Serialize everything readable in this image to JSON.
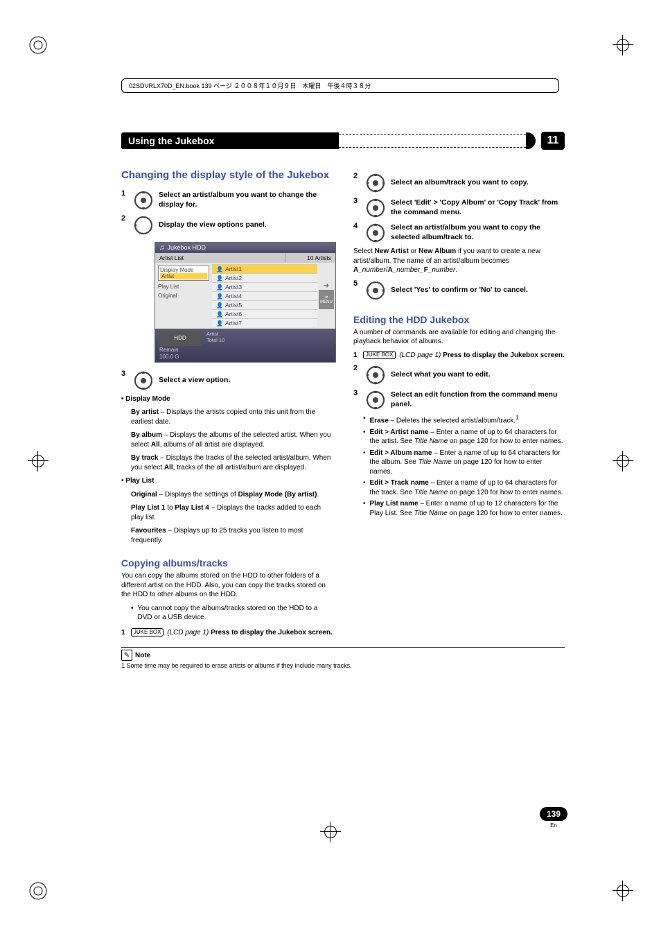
{
  "top_box": "02SDVRLX70D_EN.book  139 ページ  ２００８年１０月９日　木曜日　午後４時３８分",
  "header": {
    "title": "Using the Jukebox",
    "chapter": "11"
  },
  "left": {
    "h1": "Changing the display style of the Jukebox",
    "s1": {
      "num": "1",
      "text": "Select an artist/album you want to change the display for."
    },
    "s2": {
      "num": "2",
      "text": "Display the view options panel."
    },
    "jb": {
      "title": "Jukebox  HDD",
      "sub_left": "Artist List",
      "sub_right": "10 Artists",
      "side_mode_label": "Display Mode",
      "side_mode_val": "Artist",
      "side_playlist": "Play List",
      "side_original": "Original",
      "rows": [
        "Artist1",
        "Artist2",
        "Artist3",
        "Artist4",
        "Artist5",
        "Artist6",
        "Artist7"
      ],
      "menu_label": "MENU",
      "footer_hdd": "HDD",
      "footer_remain1": "Remain",
      "footer_remain2": "100.0 G",
      "footer_artist": "Artist",
      "footer_total": "Total   10"
    },
    "s3": {
      "num": "3",
      "text": "Select a view option."
    },
    "dm_label": "• Display Mode",
    "dm_artist_b": "By artist",
    "dm_artist_t": " – Displays the artists copied onto this unit from the earliest date.",
    "dm_album_b": "By album",
    "dm_album_t1": " – Displays the albums of the selected artist. When you select ",
    "dm_album_all": "All",
    "dm_album_t2": ", albums of all artist are displayed.",
    "dm_track_b": "By track",
    "dm_track_t1": " – Displays the tracks of the selected artist/album. When you select ",
    "dm_track_all": "All",
    "dm_track_t2": ", tracks of the all artist/album are displayed.",
    "pl_label": "• Play List",
    "pl_orig_b": "Original",
    "pl_orig_t1": " – Displays the settings of ",
    "pl_orig_t1b": "Display Mode (By artist)",
    "pl_orig_t2": ".",
    "pl_list_b1": "Play List 1",
    "pl_list_mid": " to ",
    "pl_list_b2": "Play List 4",
    "pl_list_t": " – Displays the tracks added to each play list.",
    "pl_fav_b": "Favourites",
    "pl_fav_t": " – Displays up to 25 tracks you listen to most frequently.",
    "h2": "Copying albums/tracks",
    "copy_intro": "You can copy the albums stored on the HDD to other folders of a different artist on the HDD. Also, you can copy the tracks stored on the HDD to other albums on the HDD.",
    "copy_bullet": "You cannot copy the albums/tracks stored on the HDD to a DVD or a USB device.",
    "copy_s1_num": "1",
    "copy_s1_key": "JUKE BOX",
    "copy_s1_lcd": "(LCD page 1)",
    "copy_s1_text": " Press to display the Jukebox screen."
  },
  "right": {
    "s2": {
      "num": "2",
      "text": "Select an album/track you want to copy."
    },
    "s3": {
      "num": "3",
      "text": "Select 'Edit' > 'Copy Album' or 'Copy Track' from the command menu."
    },
    "s4": {
      "num": "4",
      "text": "Select an artist/album you want to copy the selected album/track to."
    },
    "s4_body1": "Select ",
    "s4_na": "New Artist",
    "s4_or": " or ",
    "s4_nalb": "New Album",
    "s4_body2": " if you want to create a new artist/album. The name of an artist/album becomes ",
    "s4_pat_a1": "A",
    "s4_pat_n1": "_number",
    "s4_pat_slash": "/",
    "s4_pat_a2": "A",
    "s4_pat_n2": "_number_",
    "s4_pat_f": "F",
    "s4_pat_n3": "_number",
    "s4_dot": ".",
    "s5": {
      "num": "5",
      "text": "Select 'Yes' to confirm or 'No' to cancel."
    },
    "h1": "Editing the HDD Jukebox",
    "edit_intro": "A number of commands are available for editing and changing the playback behavior of albums.",
    "e1_num": "1",
    "e1_key": "JUKE BOX",
    "e1_lcd": "(LCD page 1)",
    "e1_text": " Press to display the Jukebox screen.",
    "e2": {
      "num": "2",
      "text": "Select what you want to edit."
    },
    "e3": {
      "num": "3",
      "text": "Select an edit function from the command menu panel."
    },
    "b_erase_b": "Erase",
    "b_erase_t": " – Deletes the selected artist/album/track.",
    "sup1": "1",
    "b_artist_b": "Edit > Artist name",
    "b_artist_t1": " – Enter a name of up to 64 characters for the artist. See ",
    "title_name": "Title Name",
    "on_page": " on page 120 for how to enter names.",
    "b_album_b": "Edit > Album name",
    "b_album_t1": " – Enter a name of up to 64 characters for the album. See ",
    "b_track_b": "Edit > Track name",
    "b_track_t1": " – Enter a name of up to 64 characters for the track. See ",
    "b_play_b": "Play List name",
    "b_play_t1": " – Enter a name of up to 12 characters for the Play List. See ",
    "on_page2": " on page 120 for how to enter names."
  },
  "note": {
    "label": "Note",
    "text": "1 Some time may be required to erase artists or albums if they include many tracks."
  },
  "page": {
    "num": "139",
    "lang": "En"
  }
}
